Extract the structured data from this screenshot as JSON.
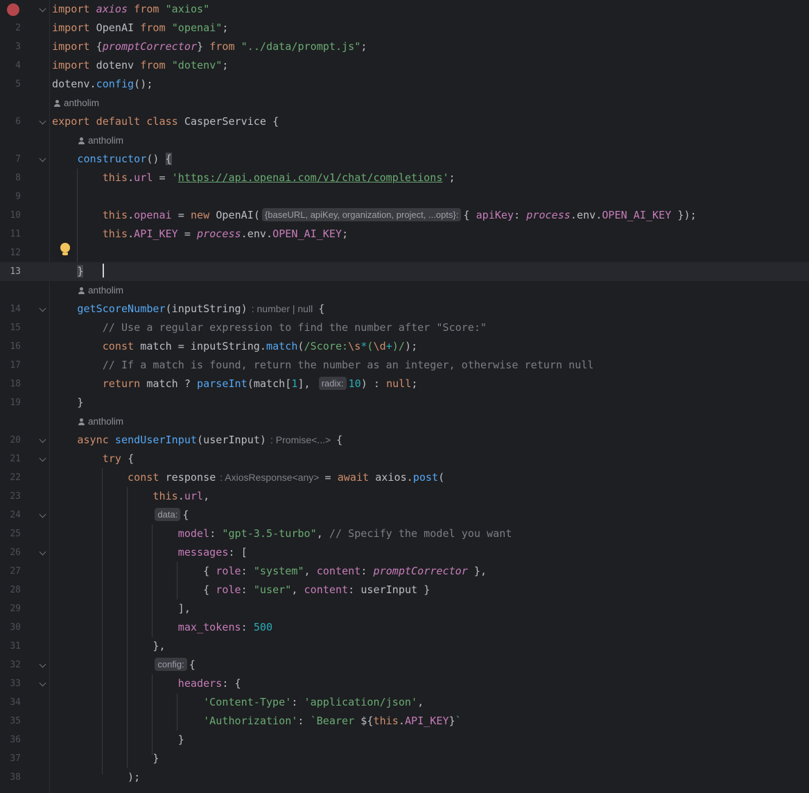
{
  "editor": {
    "author_name": "antholim",
    "current_line": "13",
    "lines": [
      {
        "ln": "",
        "tokens": [
          [
            "kw",
            "import "
          ],
          [
            "ital",
            "axios"
          ],
          [
            "kw",
            " from "
          ],
          [
            "str",
            "\"axios\""
          ]
        ]
      },
      {
        "ln": "2",
        "tokens": [
          [
            "kw",
            "import "
          ],
          [
            "",
            "OpenAI"
          ],
          [
            "kw",
            " from "
          ],
          [
            "str",
            "\"openai\""
          ],
          [
            "",
            ";"
          ]
        ]
      },
      {
        "ln": "3",
        "tokens": [
          [
            "kw",
            "import "
          ],
          [
            "",
            "{"
          ],
          [
            "ital",
            "promptCorrector"
          ],
          [
            "",
            "} "
          ],
          [
            "kw",
            "from "
          ],
          [
            "str",
            "\"../data/prompt.js\""
          ],
          [
            "",
            ";"
          ]
        ]
      },
      {
        "ln": "4",
        "tokens": [
          [
            "kw",
            "import "
          ],
          [
            "",
            "dotenv"
          ],
          [
            "kw",
            " from "
          ],
          [
            "str",
            "\"dotenv\""
          ],
          [
            "",
            ";"
          ]
        ]
      },
      {
        "ln": "5",
        "tokens": [
          [
            "",
            "dotenv."
          ],
          [
            "fn",
            "config"
          ],
          [
            "",
            "();"
          ]
        ]
      },
      {
        "ln": "6",
        "tokens": [
          [
            "kw",
            "export default class "
          ],
          [
            "",
            "CasperService {"
          ]
        ]
      },
      {
        "ln": "7",
        "tokens": [
          [
            "",
            "    "
          ],
          [
            "fn",
            "constructor"
          ],
          [
            "",
            "() "
          ],
          [
            "bracket",
            "{"
          ]
        ]
      },
      {
        "ln": "8",
        "tokens": [
          [
            "",
            "        "
          ],
          [
            "kw",
            "this"
          ],
          [
            "",
            "."
          ],
          [
            "prop",
            "url"
          ],
          [
            "",
            " = "
          ],
          [
            "str",
            "'"
          ],
          [
            "url",
            "https://api.openai.com/v1/chat/completions"
          ],
          [
            "str",
            "'"
          ],
          [
            "",
            ";"
          ]
        ]
      },
      {
        "ln": "9",
        "tokens": []
      },
      {
        "ln": "10",
        "tokens": [
          [
            "",
            "        "
          ],
          [
            "kw",
            "this"
          ],
          [
            "",
            "."
          ],
          [
            "prop",
            "openai"
          ],
          [
            "",
            " = "
          ],
          [
            "kw",
            "new "
          ],
          [
            "",
            "OpenAI("
          ],
          [
            "inlay",
            "{baseURL, apiKey, organization, project, ...opts}:"
          ],
          [
            "",
            "{ "
          ],
          [
            "prop",
            "apiKey"
          ],
          [
            "",
            ": "
          ],
          [
            "stat",
            "process"
          ],
          [
            "",
            ".env."
          ],
          [
            "prop",
            "OPEN_AI_KEY"
          ],
          [
            "",
            " });"
          ]
        ]
      },
      {
        "ln": "11",
        "tokens": [
          [
            "",
            "        "
          ],
          [
            "kw",
            "this"
          ],
          [
            "",
            "."
          ],
          [
            "prop",
            "API_KEY"
          ],
          [
            "",
            " = "
          ],
          [
            "stat",
            "process"
          ],
          [
            "",
            ".env."
          ],
          [
            "prop",
            "OPEN_AI_KEY"
          ],
          [
            "",
            ";"
          ]
        ]
      },
      {
        "ln": "12",
        "tokens": []
      },
      {
        "ln": "13",
        "tokens": [
          [
            "",
            "    "
          ],
          [
            "bracket",
            "}"
          ],
          [
            "",
            "   "
          ],
          [
            "caret",
            ""
          ]
        ]
      },
      {
        "ln": "14",
        "tokens": [
          [
            "",
            "    "
          ],
          [
            "fn",
            "getScoreNumber"
          ],
          [
            "",
            "(inputString)"
          ],
          [
            "hint",
            ": number | null"
          ],
          [
            "",
            "{"
          ]
        ]
      },
      {
        "ln": "15",
        "tokens": [
          [
            "",
            "        "
          ],
          [
            "cmt",
            "// Use a regular expression to find the number after \"Score:\""
          ]
        ]
      },
      {
        "ln": "16",
        "tokens": [
          [
            "",
            "        "
          ],
          [
            "kw",
            "const "
          ],
          [
            "",
            "match = inputString."
          ],
          [
            "fn",
            "match"
          ],
          [
            "",
            "("
          ],
          [
            "str",
            "/Score:"
          ],
          [
            "esc",
            "\\s"
          ],
          [
            "num",
            "*"
          ],
          [
            "str",
            "("
          ],
          [
            "esc",
            "\\d"
          ],
          [
            "num",
            "+"
          ],
          [
            "str",
            ")/"
          ],
          [
            "",
            ");"
          ]
        ]
      },
      {
        "ln": "17",
        "tokens": [
          [
            "",
            "        "
          ],
          [
            "cmt",
            "// If a match is found, return the number as an integer, otherwise return null"
          ]
        ]
      },
      {
        "ln": "18",
        "tokens": [
          [
            "",
            "        "
          ],
          [
            "kw",
            "return "
          ],
          [
            "",
            "match ? "
          ],
          [
            "fn",
            "parseInt"
          ],
          [
            "",
            "(match["
          ],
          [
            "num",
            "1"
          ],
          [
            "",
            "], "
          ],
          [
            "inlay",
            "radix:"
          ],
          [
            "num",
            "10"
          ],
          [
            "",
            ") : "
          ],
          [
            "kw",
            "null"
          ],
          [
            "",
            ";"
          ]
        ]
      },
      {
        "ln": "19",
        "tokens": [
          [
            "",
            "    }"
          ]
        ]
      },
      {
        "ln": "20",
        "tokens": [
          [
            "",
            "    "
          ],
          [
            "kw",
            "async "
          ],
          [
            "fn",
            "sendUserInput"
          ],
          [
            "",
            "(userInput)"
          ],
          [
            "hint",
            ": Promise<...>"
          ],
          [
            "",
            "{"
          ]
        ]
      },
      {
        "ln": "21",
        "tokens": [
          [
            "",
            "        "
          ],
          [
            "kw",
            "try "
          ],
          [
            "",
            "{"
          ]
        ]
      },
      {
        "ln": "22",
        "tokens": [
          [
            "",
            "            "
          ],
          [
            "kw",
            "const "
          ],
          [
            "",
            "response"
          ],
          [
            "hint",
            ": AxiosResponse<any>"
          ],
          [
            "",
            "= "
          ],
          [
            "kw",
            "await "
          ],
          [
            "",
            "axios."
          ],
          [
            "fn",
            "post"
          ],
          [
            "",
            "("
          ]
        ]
      },
      {
        "ln": "23",
        "tokens": [
          [
            "",
            "                "
          ],
          [
            "kw",
            "this"
          ],
          [
            "",
            "."
          ],
          [
            "prop",
            "url"
          ],
          [
            "",
            ","
          ]
        ]
      },
      {
        "ln": "24",
        "tokens": [
          [
            "",
            "                "
          ],
          [
            "inlay",
            "data:"
          ],
          [
            "",
            "{"
          ]
        ]
      },
      {
        "ln": "25",
        "tokens": [
          [
            "",
            "                    "
          ],
          [
            "prop",
            "model"
          ],
          [
            "",
            ": "
          ],
          [
            "str",
            "\"gpt-3.5-turbo\""
          ],
          [
            "",
            ", "
          ],
          [
            "cmt",
            "// Specify the model you want"
          ]
        ]
      },
      {
        "ln": "26",
        "tokens": [
          [
            "",
            "                    "
          ],
          [
            "prop",
            "messages"
          ],
          [
            "",
            ": ["
          ]
        ]
      },
      {
        "ln": "27",
        "tokens": [
          [
            "",
            "                        { "
          ],
          [
            "prop",
            "role"
          ],
          [
            "",
            ": "
          ],
          [
            "str",
            "\"system\""
          ],
          [
            "",
            ", "
          ],
          [
            "prop",
            "content"
          ],
          [
            "",
            ": "
          ],
          [
            "ital",
            "promptCorrector"
          ],
          [
            "",
            " },"
          ]
        ]
      },
      {
        "ln": "28",
        "tokens": [
          [
            "",
            "                        { "
          ],
          [
            "prop",
            "role"
          ],
          [
            "",
            ": "
          ],
          [
            "str",
            "\"user\""
          ],
          [
            "",
            ", "
          ],
          [
            "prop",
            "content"
          ],
          [
            "",
            ": userInput }"
          ]
        ]
      },
      {
        "ln": "29",
        "tokens": [
          [
            "",
            "                    ],"
          ]
        ]
      },
      {
        "ln": "30",
        "tokens": [
          [
            "",
            "                    "
          ],
          [
            "prop",
            "max_tokens"
          ],
          [
            "",
            ": "
          ],
          [
            "num",
            "500"
          ]
        ]
      },
      {
        "ln": "31",
        "tokens": [
          [
            "",
            "                },"
          ]
        ]
      },
      {
        "ln": "32",
        "tokens": [
          [
            "",
            "                "
          ],
          [
            "inlay",
            "config:"
          ],
          [
            "",
            "{"
          ]
        ]
      },
      {
        "ln": "33",
        "tokens": [
          [
            "",
            "                    "
          ],
          [
            "prop",
            "headers"
          ],
          [
            "",
            ": {"
          ]
        ]
      },
      {
        "ln": "34",
        "tokens": [
          [
            "",
            "                        "
          ],
          [
            "str",
            "'Content-Type'"
          ],
          [
            "",
            ": "
          ],
          [
            "str",
            "'application/json'"
          ],
          [
            "",
            ","
          ]
        ]
      },
      {
        "ln": "35",
        "tokens": [
          [
            "",
            "                        "
          ],
          [
            "str",
            "'Authorization'"
          ],
          [
            "",
            ": "
          ],
          [
            "str",
            "`Bearer "
          ],
          [
            "",
            "${"
          ],
          [
            "kw",
            "this"
          ],
          [
            "",
            "."
          ],
          [
            "prop",
            "API_KEY"
          ],
          [
            "",
            "}"
          ],
          [
            "str",
            "`"
          ]
        ]
      },
      {
        "ln": "36",
        "tokens": [
          [
            "",
            "                    }"
          ]
        ]
      },
      {
        "ln": "37",
        "tokens": [
          [
            "",
            "                }"
          ]
        ]
      },
      {
        "ln": "38",
        "tokens": [
          [
            "",
            "            );"
          ]
        ]
      }
    ]
  },
  "colors": {
    "background": "#1e1f22",
    "keyword": "#cf8e6d",
    "string": "#6aab73",
    "number": "#2aacb8",
    "function": "#56a8f5",
    "property": "#c77dbb",
    "comment": "#7a7e85",
    "breakpoint": "#b5464b",
    "bulb": "#f2c55c"
  },
  "icons": {
    "breakpoint": "breakpoint-icon",
    "bulb": "lightbulb-icon",
    "fold": "fold-chevron-icon",
    "author": "person-icon"
  }
}
